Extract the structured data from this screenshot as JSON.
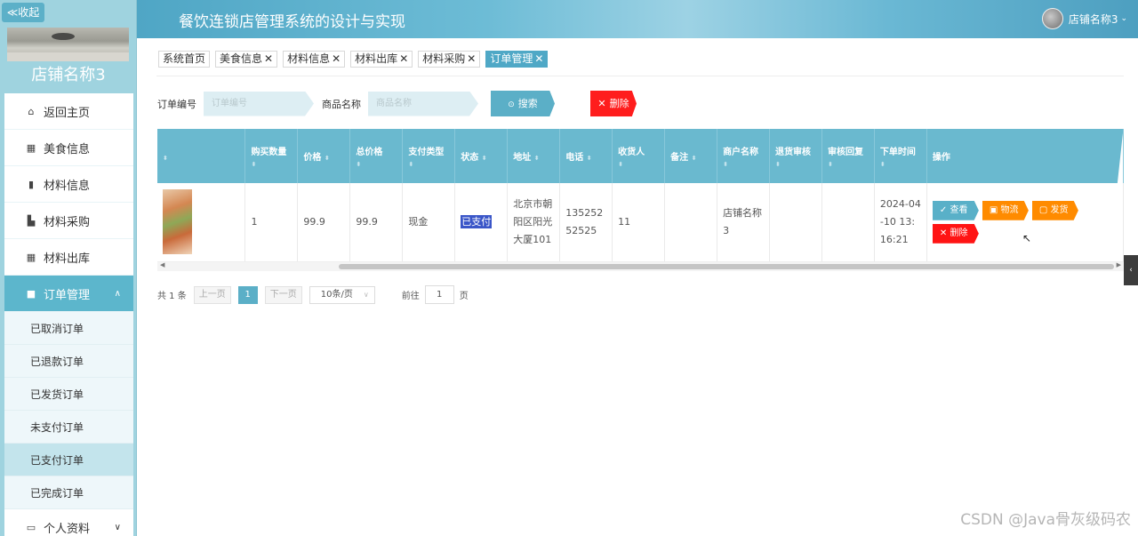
{
  "sidebar": {
    "collapse_label": "≪收起",
    "shop_name": "店铺名称3",
    "items": [
      {
        "label": "返回主页",
        "icon": "home-icon"
      },
      {
        "label": "美食信息",
        "icon": "grid-icon"
      },
      {
        "label": "材料信息",
        "icon": "clipboard-icon"
      },
      {
        "label": "材料采购",
        "icon": "thumbs-up-icon"
      },
      {
        "label": "材料出库",
        "icon": "grid-icon"
      }
    ],
    "active_group": {
      "label": "订单管理",
      "icon": "briefcase-icon"
    },
    "sub_items": [
      "已取消订单",
      "已退款订单",
      "已发货订单",
      "未支付订单",
      "已支付订单",
      "已完成订单"
    ],
    "profile": {
      "label": "个人资料",
      "icon": "card-icon"
    }
  },
  "header": {
    "title": "餐饮连锁店管理系统的设计与实现",
    "user_name": "店铺名称3"
  },
  "tabs": [
    {
      "label": "系统首页",
      "closable": false
    },
    {
      "label": "美食信息",
      "closable": true
    },
    {
      "label": "材料信息",
      "closable": true
    },
    {
      "label": "材料出库",
      "closable": true
    },
    {
      "label": "材料采购",
      "closable": true
    },
    {
      "label": "订单管理",
      "closable": true,
      "active": true
    }
  ],
  "search": {
    "order_no_label": "订单编号",
    "order_no_placeholder": "订单编号",
    "product_label": "商品名称",
    "product_placeholder": "商品名称",
    "search_button": "搜索",
    "delete_button": "删除"
  },
  "table": {
    "headers": [
      "",
      "购买数量",
      "价格",
      "总价格",
      "支付类型",
      "状态",
      "地址",
      "电话",
      "收货人",
      "备注",
      "商户名称",
      "退货审核",
      "审核回复",
      "下单时间",
      "操作"
    ],
    "row": {
      "quantity": "1",
      "price": "99.9",
      "total": "99.9",
      "pay_type": "现金",
      "status": "已支付",
      "address": "北京市朝阳区阳光大厦101",
      "phone": "13525252525",
      "receiver": "11",
      "remark": "",
      "merchant": "店铺名称3",
      "return_review": "",
      "review_reply": "",
      "order_time": "2024-04-10 13:16:21"
    },
    "actions": {
      "view": "查看",
      "logistics": "物流",
      "ship": "发货",
      "delete": "删除"
    }
  },
  "pager": {
    "total": "共 1 条",
    "prev": "上一页",
    "current": "1",
    "next": "下一页",
    "page_size": "10条/页",
    "goto_label": "前往",
    "goto_value": "1",
    "page_unit": "页"
  },
  "watermark": "CSDN @Java骨灰级码农"
}
